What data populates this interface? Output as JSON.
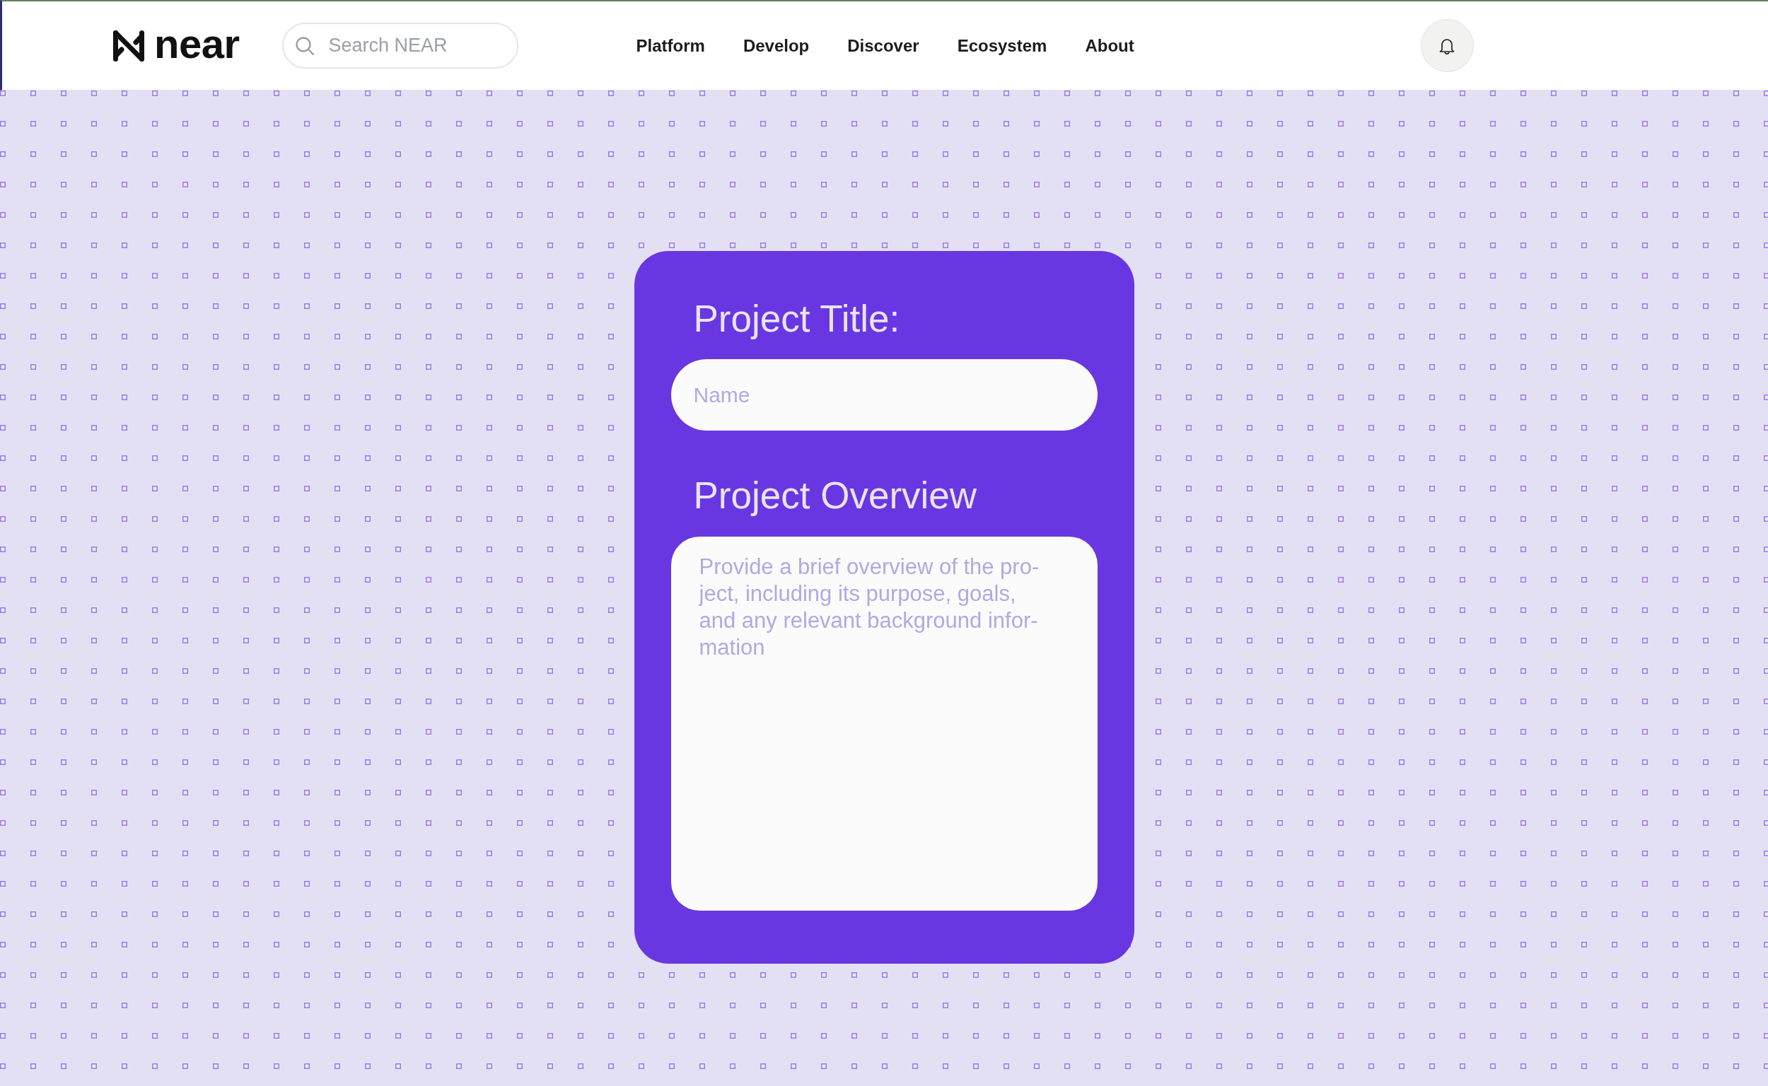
{
  "header": {
    "logo": {
      "text": "near"
    },
    "search": {
      "placeholder": "Search NEAR"
    },
    "nav": [
      "Platform",
      "Develop",
      "Discover",
      "Ecosystem",
      "About"
    ]
  },
  "form": {
    "fields": [
      {
        "kind": "input",
        "label": "Project Title:",
        "placeholder": "Name"
      },
      {
        "kind": "textarea",
        "label": "Project Overview",
        "placeholder": "Provide a brief overview of the pro-\nject, including its purpose, goals,\nand any relevant background infor-\nmation"
      }
    ]
  }
}
